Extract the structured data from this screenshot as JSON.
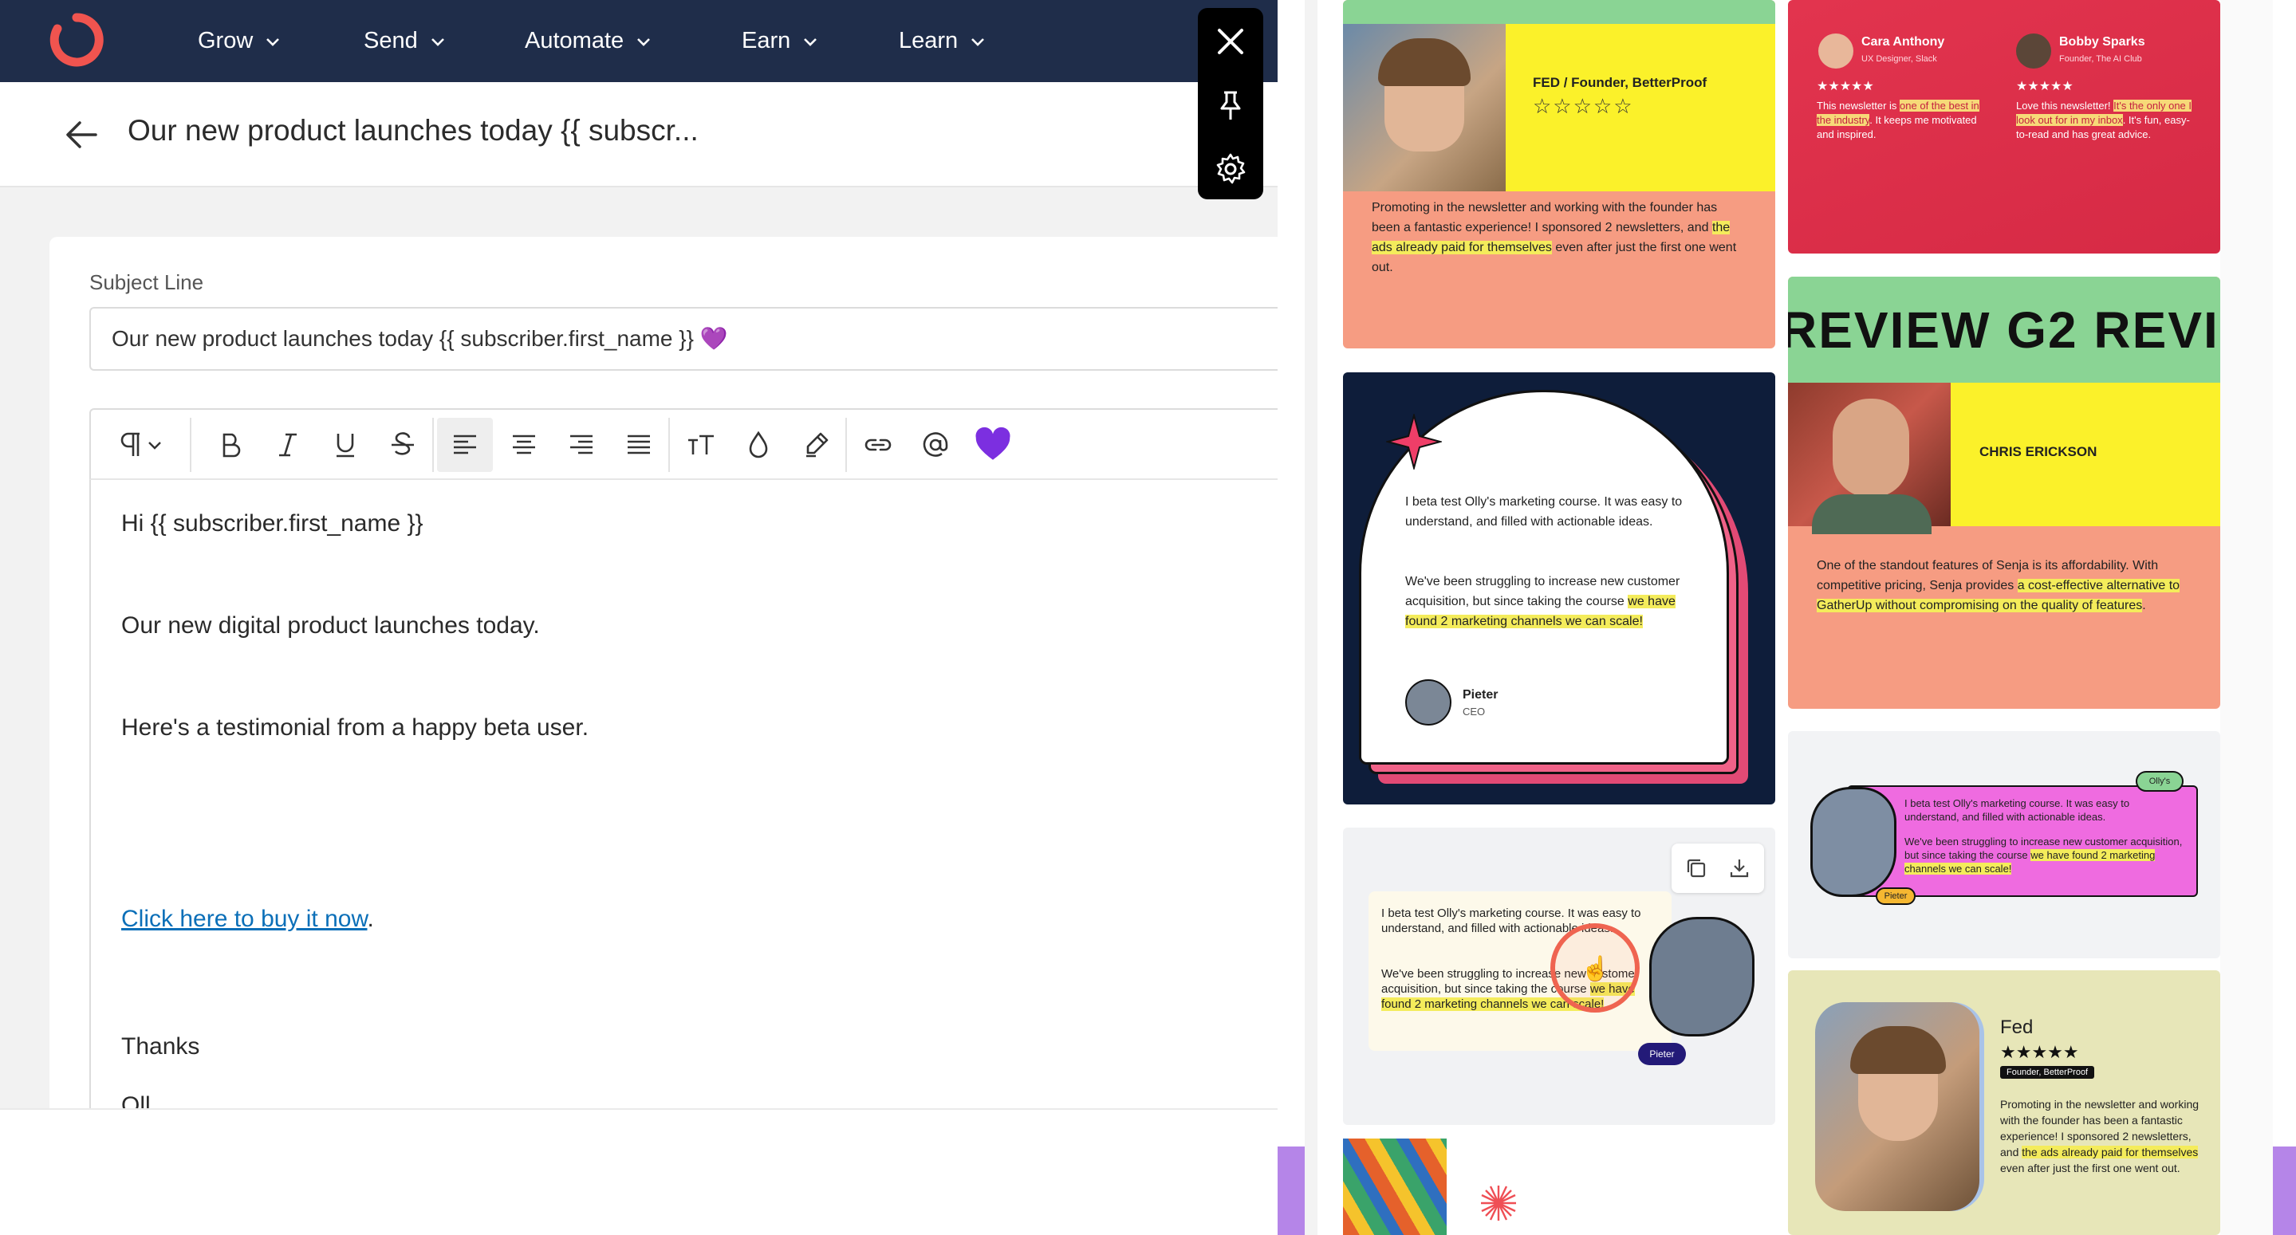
{
  "nav": {
    "items": [
      {
        "label": "Grow"
      },
      {
        "label": "Send"
      },
      {
        "label": "Automate"
      },
      {
        "label": "Earn"
      },
      {
        "label": "Learn"
      }
    ]
  },
  "page": {
    "title": "Our new product launches today {{ subscr..."
  },
  "editor": {
    "subject_label": "Subject Line",
    "subject_value": "Our new product launches today {{ subscriber.first_name }} 💜",
    "body": {
      "greeting": "Hi {{ subscriber.first_name }}",
      "line1": "Our new digital product launches today.",
      "line2": "Here's a testimonial from a happy beta user.",
      "link_text": "Click here to buy it now",
      "link_suffix": ".",
      "thanks": "Thanks",
      "signoff_partial": "Oll"
    }
  },
  "colors": {
    "nav_bg": "#1f2d4a",
    "brand": "#f0544f",
    "link": "#0b6fb8",
    "heart": "#7c2fe0"
  },
  "testimonials": {
    "t1": {
      "name": "FED / Founder, BetterProof",
      "quote_a": "Promoting in the newsletter and working with the founder has been a fantastic experience! I sponsored 2 newsletters, and ",
      "quote_hl": "the ads already paid for themselves",
      "quote_b": " even after just the first one went out."
    },
    "t2": {
      "p1_name": "Cara Anthony",
      "p1_role": "UX Designer, Slack",
      "p1_a": "This newsletter is ",
      "p1_hl": "one of the best in the industry",
      "p1_b": ". It keeps me motivated and inspired.",
      "p2_name": "Bobby Sparks",
      "p2_role": "Founder, The AI Club",
      "p2_a": "Love this newsletter! ",
      "p2_hl": "It's the only one I look out for in my inbox",
      "p2_b": ". It's fun, easy-to-read and has great advice."
    },
    "t3": {
      "banner": "REVIEW  G2 REVI",
      "name": "CHRIS ERICKSON",
      "quote_a": "One of the standout features of Senja is its affordability. With competitive pricing, Senja provides ",
      "quote_hl": "a cost-effective alternative to GatherUp without compromising on the quality of features",
      "quote_b": "."
    },
    "t4": {
      "quote1": "I beta test Olly's marketing course. It was easy to understand, and filled with actionable ideas.",
      "quote2_a": "We've been struggling to increase new customer acquisition, but since taking the course ",
      "quote2_hl": "we have found 2 marketing channels we can scale!",
      "name": "Pieter",
      "role": "CEO"
    },
    "t5": {
      "quote1": "I beta test Olly's marketing course. It was easy to understand, and filled with actionable ideas.",
      "quote2_a": "We've been struggling to increase new customer acquisition, but since taking the course ",
      "quote2_hl": "we have found 2 marketing channels we can scale!",
      "name": "Pieter",
      "badge": "Olly's"
    },
    "t6": {
      "quote1": "I beta test Olly's marketing course. It was easy to understand, and filled with actionable ideas.",
      "quote2_a": "We've been struggling to increase new customer acquisition, but since taking the course ",
      "quote2_hl": "we have found 2 marketing channels we can scale!",
      "name": "Pieter"
    },
    "t7": {
      "name": "Fed",
      "role": "Founder, BetterProof",
      "quote_a": "Promoting in the newsletter and working with the founder has been a fantastic experience! I sponsored 2 newsletters, and ",
      "quote_hl": "the ads already paid for themselves",
      "quote_b": " even after just the first one went out."
    }
  }
}
